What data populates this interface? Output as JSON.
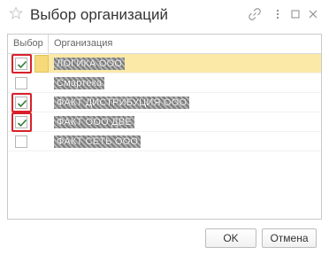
{
  "window": {
    "title": "Выбор организаций"
  },
  "icons": {
    "favorite": "star-icon",
    "link": "link-icon",
    "more": "more-icon",
    "maximize": "maximize-icon",
    "close": "close-icon"
  },
  "table": {
    "columns": [
      "Выбор",
      "Организация"
    ],
    "rows": [
      {
        "checked": true,
        "name": "ЛОГИКА ООО"
      },
      {
        "checked": false,
        "name": "Смартека"
      },
      {
        "checked": true,
        "name": "ФАКТ ДИСТРИБУЦИЯ ООО"
      },
      {
        "checked": true,
        "name": "ФАКТ ООО ДВЕ"
      },
      {
        "checked": false,
        "name": "ФАКТ СЕТЬ ООО"
      }
    ]
  },
  "buttons": {
    "ok": "OK",
    "cancel": "Отмена"
  },
  "colors": {
    "selection": "#fbe9a8",
    "check": "#2e7d32",
    "highlight_frame": "#d9202a"
  }
}
